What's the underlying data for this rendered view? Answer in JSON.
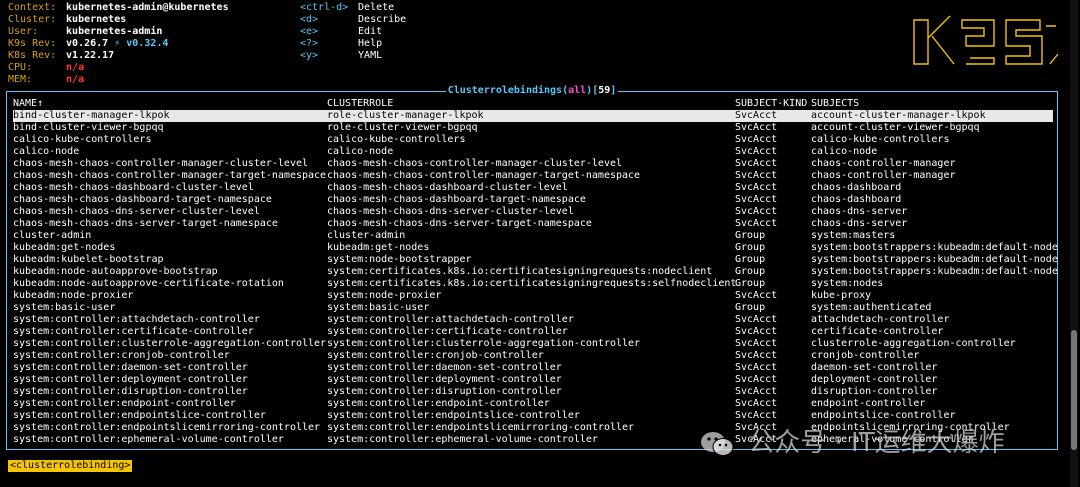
{
  "info": {
    "context_label": "Context:",
    "context_value": "kubernetes-admin@kubernetes",
    "cluster_label": "Cluster:",
    "cluster_value": "kubernetes",
    "user_label": "User:",
    "user_value": "kubernetes-admin",
    "k9s_label": "K9s Rev:",
    "k9s_value": "v0.26.7",
    "k9s_upgrade": "⚡ v0.32.4",
    "k8s_label": "K8s Rev:",
    "k8s_value": "v1.22.17",
    "cpu_label": "CPU:",
    "cpu_value": "n/a",
    "mem_label": "MEM:",
    "mem_value": "n/a"
  },
  "hints": [
    {
      "key": "<ctrl-d>",
      "label": "Delete"
    },
    {
      "key": "<d>",
      "label": "Describe"
    },
    {
      "key": "<e>",
      "label": "Edit"
    },
    {
      "key": "<?>",
      "label": "Help"
    },
    {
      "key": "<y>",
      "label": "YAML"
    }
  ],
  "title": {
    "name": "Clusterrolebindings",
    "filter": "all",
    "count": "59"
  },
  "columns": [
    "NAME↑",
    "CLUSTERROLE",
    "SUBJECT-KIND",
    "SUBJECTS"
  ],
  "rows": [
    [
      "bind-cluster-manager-lkpok",
      "role-cluster-manager-lkpok",
      "SvcAcct",
      "account-cluster-manager-lkpok"
    ],
    [
      "bind-cluster-viewer-bgpqq",
      "role-cluster-viewer-bgpqq",
      "SvcAcct",
      "account-cluster-viewer-bgpqq"
    ],
    [
      "calico-kube-controllers",
      "calico-kube-controllers",
      "SvcAcct",
      "calico-kube-controllers"
    ],
    [
      "calico-node",
      "calico-node",
      "SvcAcct",
      "calico-node"
    ],
    [
      "chaos-mesh-chaos-controller-manager-cluster-level",
      "chaos-mesh-chaos-controller-manager-cluster-level",
      "SvcAcct",
      "chaos-controller-manager"
    ],
    [
      "chaos-mesh-chaos-controller-manager-target-namespace",
      "chaos-mesh-chaos-controller-manager-target-namespace",
      "SvcAcct",
      "chaos-controller-manager"
    ],
    [
      "chaos-mesh-chaos-dashboard-cluster-level",
      "chaos-mesh-chaos-dashboard-cluster-level",
      "SvcAcct",
      "chaos-dashboard"
    ],
    [
      "chaos-mesh-chaos-dashboard-target-namespace",
      "chaos-mesh-chaos-dashboard-target-namespace",
      "SvcAcct",
      "chaos-dashboard"
    ],
    [
      "chaos-mesh-chaos-dns-server-cluster-level",
      "chaos-mesh-chaos-dns-server-cluster-level",
      "SvcAcct",
      "chaos-dns-server"
    ],
    [
      "chaos-mesh-chaos-dns-server-target-namespace",
      "chaos-mesh-chaos-dns-server-target-namespace",
      "SvcAcct",
      "chaos-dns-server"
    ],
    [
      "cluster-admin",
      "cluster-admin",
      "Group",
      "system:masters"
    ],
    [
      "kubeadm:get-nodes",
      "kubeadm:get-nodes",
      "Group",
      "system:bootstrappers:kubeadm:default-node"
    ],
    [
      "kubeadm:kubelet-bootstrap",
      "system:node-bootstrapper",
      "Group",
      "system:bootstrappers:kubeadm:default-node"
    ],
    [
      "kubeadm:node-autoapprove-bootstrap",
      "system:certificates.k8s.io:certificatesigningrequests:nodeclient",
      "Group",
      "system:bootstrappers:kubeadm:default-node"
    ],
    [
      "kubeadm:node-autoapprove-certificate-rotation",
      "system:certificates.k8s.io:certificatesigningrequests:selfnodeclient",
      "Group",
      "system:nodes"
    ],
    [
      "kubeadm:node-proxier",
      "system:node-proxier",
      "SvcAcct",
      "kube-proxy"
    ],
    [
      "system:basic-user",
      "system:basic-user",
      "Group",
      "system:authenticated"
    ],
    [
      "system:controller:attachdetach-controller",
      "system:controller:attachdetach-controller",
      "SvcAcct",
      "attachdetach-controller"
    ],
    [
      "system:controller:certificate-controller",
      "system:controller:certificate-controller",
      "SvcAcct",
      "certificate-controller"
    ],
    [
      "system:controller:clusterrole-aggregation-controller",
      "system:controller:clusterrole-aggregation-controller",
      "SvcAcct",
      "clusterrole-aggregation-controller"
    ],
    [
      "system:controller:cronjob-controller",
      "system:controller:cronjob-controller",
      "SvcAcct",
      "cronjob-controller"
    ],
    [
      "system:controller:daemon-set-controller",
      "system:controller:daemon-set-controller",
      "SvcAcct",
      "daemon-set-controller"
    ],
    [
      "system:controller:deployment-controller",
      "system:controller:deployment-controller",
      "SvcAcct",
      "deployment-controller"
    ],
    [
      "system:controller:disruption-controller",
      "system:controller:disruption-controller",
      "SvcAcct",
      "disruption-controller"
    ],
    [
      "system:controller:endpoint-controller",
      "system:controller:endpoint-controller",
      "SvcAcct",
      "endpoint-controller"
    ],
    [
      "system:controller:endpointslice-controller",
      "system:controller:endpointslice-controller",
      "SvcAcct",
      "endpointslice-controller"
    ],
    [
      "system:controller:endpointslicemirroring-controller",
      "system:controller:endpointslicemirroring-controller",
      "SvcAcct",
      "endpointslicemirroring-controller"
    ],
    [
      "system:controller:ephemeral-volume-controller",
      "system:controller:ephemeral-volume-controller",
      "SvcAcct",
      "ephemeral-volume-controller"
    ]
  ],
  "selected_row": 0,
  "crumb": "<clusterrolebinding>",
  "watermark": "公众号 · IT运维大爆炸",
  "colors": {
    "accent": "#5ac8fa",
    "label": "#d4a017",
    "crumb_bg": "#f5c400",
    "all": "#ff4dd2",
    "na": "#ff3b3b"
  }
}
